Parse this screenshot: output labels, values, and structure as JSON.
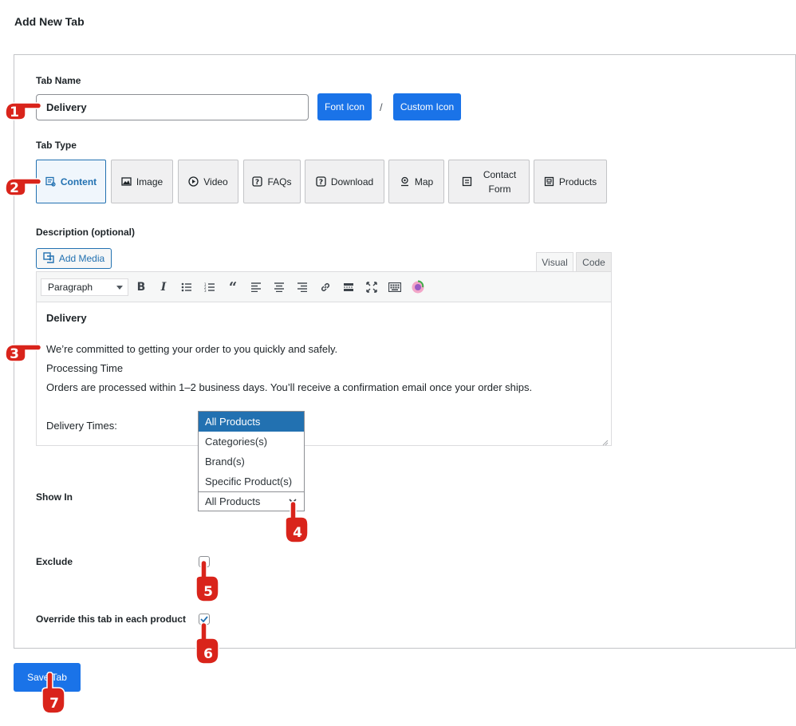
{
  "page": {
    "title": "Add New Tab"
  },
  "tab_name": {
    "label": "Tab Name",
    "value": "Delivery"
  },
  "icon_buttons": {
    "font_icon": "Font Icon",
    "separator": "/",
    "custom_icon": "Custom Icon"
  },
  "tab_type": {
    "label": "Tab Type",
    "items": [
      {
        "label": "Content",
        "icon": "content-icon",
        "active": true
      },
      {
        "label": "Image",
        "icon": "image-icon",
        "active": false
      },
      {
        "label": "Video",
        "icon": "play-icon",
        "active": false
      },
      {
        "label": "FAQs",
        "icon": "question-icon",
        "active": false
      },
      {
        "label": "Download",
        "icon": "question-icon",
        "active": false
      },
      {
        "label": "Map",
        "icon": "map-pin-icon",
        "active": false
      },
      {
        "label_line1": "Contact",
        "label_line2": "Form",
        "icon": "form-icon",
        "active": false
      },
      {
        "label": "Products",
        "icon": "products-icon",
        "active": false
      }
    ]
  },
  "description": {
    "label": "Description (optional)",
    "add_media": "Add Media",
    "tabs": {
      "visual": "Visual",
      "code": "Code"
    },
    "format_select": "Paragraph",
    "content": {
      "heading": "Delivery",
      "line1": "We’re committed to getting your order to you quickly and safely.",
      "line2": "Processing Time",
      "line3": "Orders are processed within 1–2 business days. You’ll receive a confirmation email once your order ships.",
      "line4": "Delivery Times:"
    }
  },
  "show_in": {
    "label": "Show In",
    "options": [
      "All Products",
      "Categories(s)",
      "Brand(s)",
      "Specific Product(s)"
    ],
    "selected": "All Products"
  },
  "exclude": {
    "label": "Exclude",
    "checked": false
  },
  "override": {
    "label": "Override this tab in each product",
    "checked": true
  },
  "save": {
    "label": "Save Tab"
  },
  "markers": [
    "1",
    "2",
    "3",
    "4",
    "5",
    "6",
    "7"
  ],
  "colors": {
    "primary": "#1a73e8",
    "marker": "#d9241b",
    "accent": "#2271b1"
  }
}
